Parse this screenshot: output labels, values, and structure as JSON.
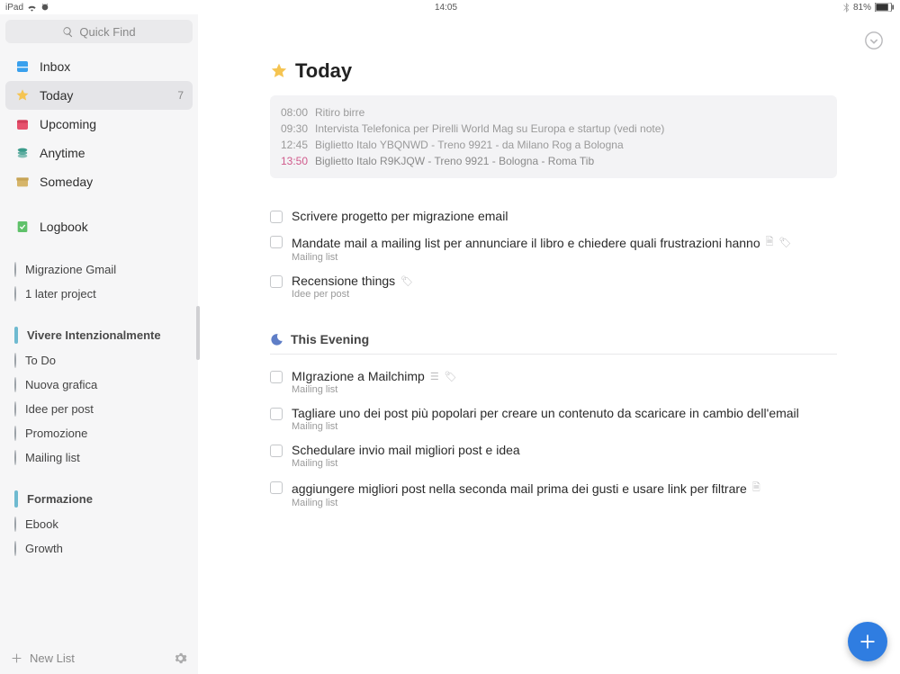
{
  "status": {
    "device": "iPad",
    "time": "14:05",
    "battery": "81%"
  },
  "search": {
    "placeholder": "Quick Find"
  },
  "nav": {
    "inbox": "Inbox",
    "today": "Today",
    "today_badge": "7",
    "upcoming": "Upcoming",
    "anytime": "Anytime",
    "someday": "Someday",
    "logbook": "Logbook"
  },
  "projects_top": [
    {
      "label": "Migrazione Gmail"
    },
    {
      "label": "1 later project"
    }
  ],
  "areas": [
    {
      "label": "Vivere Intenzionalmente",
      "items": [
        "To Do",
        "Nuova grafica",
        "Idee per post",
        "Promozione",
        "Mailing list"
      ]
    },
    {
      "label": "Formazione",
      "items": [
        "Ebook",
        "Growth"
      ]
    }
  ],
  "footer": {
    "newlist": "New List"
  },
  "page": {
    "title": "Today",
    "calendar": [
      {
        "time": "08:00",
        "text": "Ritiro birre"
      },
      {
        "time": "09:30",
        "text": "Intervista Telefonica per Pirelli World Mag su Europa e startup (vedi note)"
      },
      {
        "time": "12:45",
        "text": "Biglietto Italo YBQNWD - Treno 9921 - da Milano Rog a Bologna"
      },
      {
        "time": "13:50",
        "text": "Biglietto Italo R9KJQW - Treno 9921 - Bologna - Roma Tib",
        "upcoming": true
      }
    ],
    "tasks": [
      {
        "title": "Scrivere progetto per migrazione email"
      },
      {
        "title": "Mandate mail a mailing list per annunciare il libro e chiedere quali frustrazioni hanno",
        "sub": "Mailing list",
        "note": true,
        "tag": true
      },
      {
        "title": "Recensione things",
        "sub": "Idee per post",
        "tag": true
      }
    ],
    "evening_label": "This Evening",
    "evening_tasks": [
      {
        "title": "MIgrazione a Mailchimp",
        "sub": "Mailing list",
        "checklist": true,
        "tag": true
      },
      {
        "title": "Tagliare uno dei post più popolari per creare un contenuto da scaricare in cambio dell'email",
        "sub": "Mailing list"
      },
      {
        "title": "Schedulare invio mail migliori post e idea",
        "sub": "Mailing list"
      },
      {
        "title": "aggiungere migliori post nella seconda mail prima dei gusti e usare link per filtrare",
        "sub": "Mailing list",
        "note": true
      }
    ]
  }
}
